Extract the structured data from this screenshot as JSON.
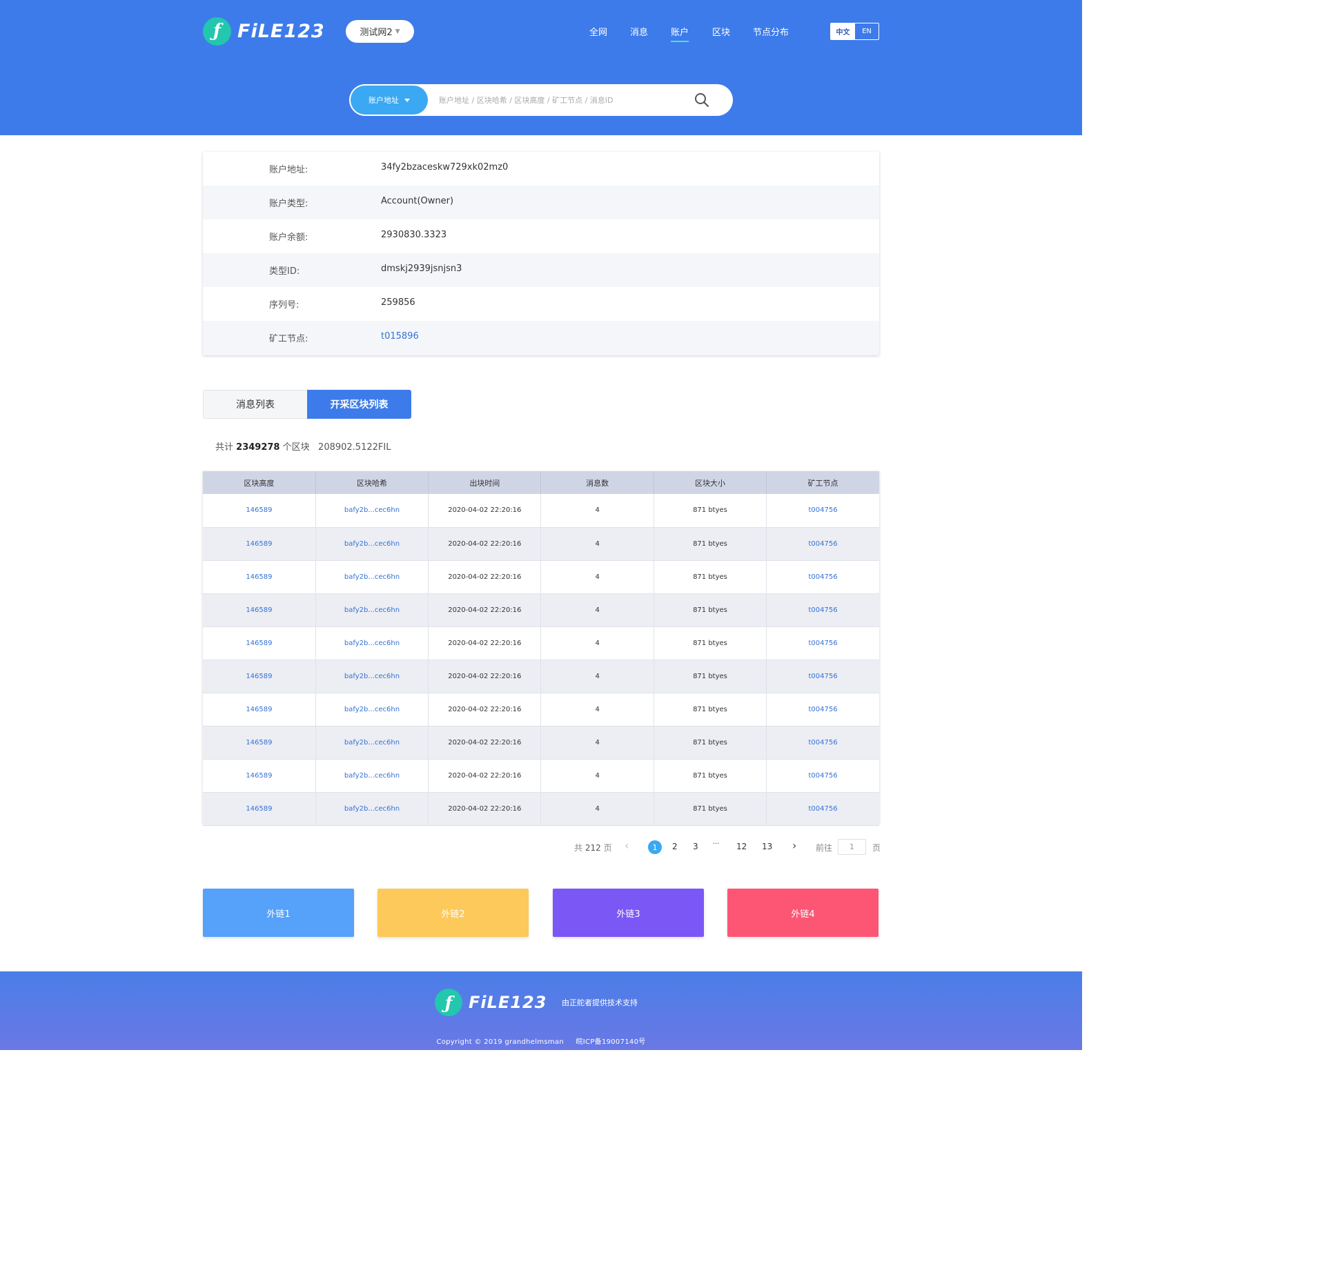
{
  "header": {
    "logo_mark": "ƒ",
    "logo_text": "FiLE123",
    "network": "测试网2",
    "nav": [
      "全网",
      "消息",
      "账户",
      "区块",
      "节点分布"
    ],
    "nav_active": "账户",
    "lang_zh": "中文",
    "lang_en": "EN"
  },
  "search": {
    "type_label": "账户地址",
    "placeholder": "账户地址 / 区块哈希 / 区块高度 / 矿工节点 / 消息ID"
  },
  "account": {
    "rows": [
      {
        "label": "账户地址:",
        "value": "34fy2bzaceskw729xk02mz0"
      },
      {
        "label": "账户类型:",
        "value": "Account(Owner)"
      },
      {
        "label": "账户余额:",
        "value": "2930830.3323"
      },
      {
        "label": "类型ID:",
        "value": "dmskj2939jsnjsn3"
      },
      {
        "label": "序列号:",
        "value": "259856"
      },
      {
        "label": "矿工节点:",
        "value": "t015896"
      }
    ]
  },
  "tabs": {
    "messages": "消息列表",
    "blocks": "开采区块列表"
  },
  "summary": {
    "prefix": "共计",
    "count": "2349278",
    "unit": "个区块",
    "amount": "208902.5122FIL"
  },
  "table": {
    "headers": [
      "区块高度",
      "区块哈希",
      "出块时间",
      "消息数",
      "区块大小",
      "矿工节点"
    ],
    "rows": [
      [
        "146589",
        "bafy2b...cec6hn",
        "2020-04-02 22:20:16",
        "4",
        "871 btyes",
        "t004756"
      ],
      [
        "146589",
        "bafy2b...cec6hn",
        "2020-04-02 22:20:16",
        "4",
        "871 btyes",
        "t004756"
      ],
      [
        "146589",
        "bafy2b...cec6hn",
        "2020-04-02 22:20:16",
        "4",
        "871 btyes",
        "t004756"
      ],
      [
        "146589",
        "bafy2b...cec6hn",
        "2020-04-02 22:20:16",
        "4",
        "871 btyes",
        "t004756"
      ],
      [
        "146589",
        "bafy2b...cec6hn",
        "2020-04-02 22:20:16",
        "4",
        "871 btyes",
        "t004756"
      ],
      [
        "146589",
        "bafy2b...cec6hn",
        "2020-04-02 22:20:16",
        "4",
        "871 btyes",
        "t004756"
      ],
      [
        "146589",
        "bafy2b...cec6hn",
        "2020-04-02 22:20:16",
        "4",
        "871 btyes",
        "t004756"
      ],
      [
        "146589",
        "bafy2b...cec6hn",
        "2020-04-02 22:20:16",
        "4",
        "871 btyes",
        "t004756"
      ],
      [
        "146589",
        "bafy2b...cec6hn",
        "2020-04-02 22:20:16",
        "4",
        "871 btyes",
        "t004756"
      ],
      [
        "146589",
        "bafy2b...cec6hn",
        "2020-04-02 22:20:16",
        "4",
        "871 btyes",
        "t004756"
      ]
    ]
  },
  "pagination": {
    "total_prefix": "共",
    "total_pages": "212",
    "total_suffix": "页",
    "pages": [
      "1",
      "2",
      "3",
      "···",
      "12",
      "13"
    ],
    "current": "1",
    "goto_label": "前往",
    "goto_value": "1",
    "goto_suffix": "页"
  },
  "external_links": [
    {
      "label": "外链1",
      "color": "#56a1f9"
    },
    {
      "label": "外链2",
      "color": "#fdc95a"
    },
    {
      "label": "外链3",
      "color": "#7b57f6"
    },
    {
      "label": "外链4",
      "color": "#fd5675"
    }
  ],
  "footer": {
    "logo_mark": "ƒ",
    "logo_text": "FiLE123",
    "support": "由正舵者提供技术支持",
    "copyright": "Copyright © 2019 grandhelmsman",
    "icp": "皖ICP备19007140号"
  },
  "colors": {
    "primary": "#3d7bea",
    "accent_teal": "#22c7ad",
    "link": "#3471d6",
    "pager_active": "#3aa8f2"
  }
}
